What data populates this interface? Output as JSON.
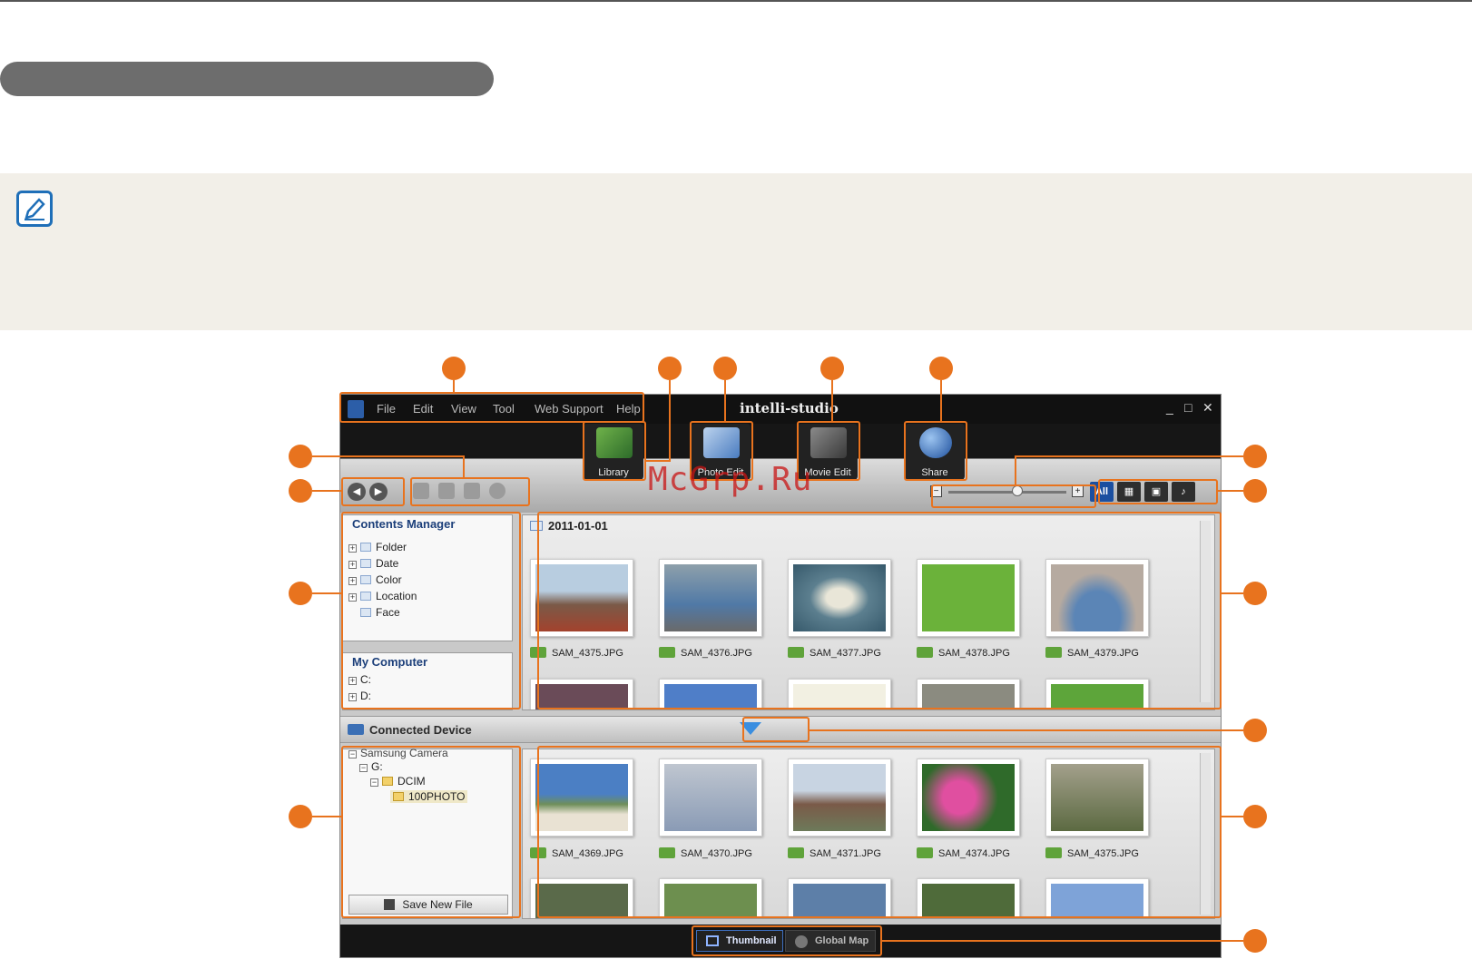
{
  "app": {
    "title": "intelli-studio",
    "menu": [
      "File",
      "Edit",
      "View",
      "Tool",
      "Web Support",
      "Help"
    ],
    "window_controls": [
      "_",
      "□",
      "✕"
    ]
  },
  "modes": [
    {
      "label": "Library",
      "icon": "library-icon"
    },
    {
      "label": "Photo Edit",
      "icon": "photo-edit-icon"
    },
    {
      "label": "Movie Edit",
      "icon": "movie-edit-icon"
    },
    {
      "label": "Share",
      "icon": "share-icon"
    }
  ],
  "filters": [
    "All",
    "movie",
    "photo",
    "voice"
  ],
  "contents_manager": {
    "title": "Contents Manager",
    "items": [
      "Folder",
      "Date",
      "Color",
      "Location",
      "Face"
    ]
  },
  "my_computer": {
    "title": "My Computer",
    "drives": [
      "C:",
      "D:"
    ]
  },
  "library_gallery": {
    "date": "2011-01-01",
    "files": [
      "SAM_4375.JPG",
      "SAM_4376.JPG",
      "SAM_4377.JPG",
      "SAM_4378.JPG",
      "SAM_4379.JPG"
    ]
  },
  "connected_device": {
    "title": "Connected Device",
    "tree": [
      "Samsung Camera",
      "G:",
      "DCIM",
      "100PHOTO"
    ],
    "save_button": "Save New File",
    "files": [
      "SAM_4369.JPG",
      "SAM_4370.JPG",
      "SAM_4371.JPG",
      "SAM_4374.JPG",
      "SAM_4375.JPG"
    ]
  },
  "view_tabs": [
    "Thumbnail",
    "Global Map"
  ],
  "watermark": "McGrp.Ru",
  "colors": {
    "callout": "#e8731e",
    "accent": "#1b4fa0",
    "note_bg": "#f2efe8"
  }
}
